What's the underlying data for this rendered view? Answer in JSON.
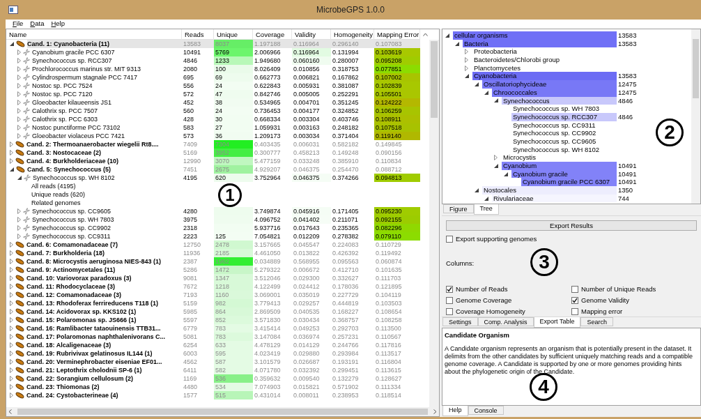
{
  "window": {
    "title": "MicrobeGPS 1.0.0"
  },
  "menu": [
    "File",
    "Data",
    "Help"
  ],
  "table": {
    "columns": [
      "Name",
      "Reads",
      "Unique",
      "Coverage",
      "Validity",
      "Homogeneity",
      "Mapping Error"
    ],
    "rows": [
      {
        "kind": "candidate",
        "name": "Cand. 1: Cyanobacteria (11)",
        "expanded": true,
        "selected": true,
        "reads": "13583",
        "unique": {
          "value": "8037",
          "color": "#66ee66"
        },
        "coverage": "1.197188",
        "validity": "0.116964",
        "homogeneity": "0.296140",
        "mapping_error": "0.107083",
        "children": [
          {
            "kind": "genome",
            "name": "Cyanobium gracile PCC 6307",
            "expanded": false,
            "selected": false,
            "reads": "10491",
            "unique": {
              "value": "5769",
              "color": "#6cf56c"
            },
            "coverage": "2.006966",
            "validity": {
              "value": "0.116964",
              "color": "#e2fbe2"
            },
            "homogeneity": "0.131994",
            "mapping_error": {
              "value": "0.103619",
              "color": "#a8c800"
            }
          },
          {
            "kind": "genome",
            "name": "Synechococcus sp. RCC307",
            "expanded": false,
            "selected": false,
            "reads": "4846",
            "unique": {
              "value": "1233",
              "color": "#b8f8b8"
            },
            "coverage": "1.949680",
            "validity": {
              "value": "0.060160",
              "color": "#f0fcf0"
            },
            "homogeneity": "0.280007",
            "mapping_error": {
              "value": "0.095208",
              "color": "#a0cc00"
            }
          },
          {
            "kind": "genome",
            "name": "Prochlorococcus marinus str. MIT 9313",
            "expanded": false,
            "selected": false,
            "reads": "2080",
            "unique": {
              "value": "100",
              "color": "#eafbea"
            },
            "coverage": "8.026409",
            "validity": "0.010856",
            "homogeneity": "0.318753",
            "mapping_error": {
              "value": "0.077851",
              "color": "#8cdc00"
            }
          },
          {
            "kind": "genome",
            "name": "Cylindrospermum stagnale PCC 7417",
            "expanded": false,
            "selected": false,
            "reads": "695",
            "unique": {
              "value": "69",
              "color": "#eefcee"
            },
            "coverage": "0.662773",
            "validity": "0.006821",
            "homogeneity": "0.167862",
            "mapping_error": {
              "value": "0.107002",
              "color": "#a8c400"
            }
          },
          {
            "kind": "genome",
            "name": "Nostoc sp. PCC 7524",
            "expanded": false,
            "selected": false,
            "reads": "556",
            "unique": {
              "value": "24",
              "color": "#f3fdf3"
            },
            "coverage": "0.622843",
            "validity": "0.005931",
            "homogeneity": "0.381087",
            "mapping_error": {
              "value": "0.102839",
              "color": "#a8c800"
            }
          },
          {
            "kind": "genome",
            "name": "Nostoc sp. PCC 7120",
            "expanded": false,
            "selected": false,
            "reads": "572",
            "unique": {
              "value": "47",
              "color": "#effcef"
            },
            "coverage": "0.842746",
            "validity": "0.005005",
            "homogeneity": "0.252291",
            "mapping_error": {
              "value": "0.105501",
              "color": "#aac600"
            }
          },
          {
            "kind": "genome",
            "name": "Gloeobacter kilaueensis JS1",
            "expanded": false,
            "selected": false,
            "reads": "452",
            "unique": {
              "value": "38",
              "color": "#f1fcf1"
            },
            "coverage": "0.534965",
            "validity": "0.004701",
            "homogeneity": "0.351245",
            "mapping_error": {
              "value": "0.124222",
              "color": "#b4b800"
            }
          },
          {
            "kind": "genome",
            "name": "Calothrix sp. PCC 7507",
            "expanded": false,
            "selected": false,
            "reads": "560",
            "unique": {
              "value": "24",
              "color": "#f3fdf3"
            },
            "coverage": "0.736453",
            "validity": "0.004177",
            "homogeneity": "0.324852",
            "mapping_error": {
              "value": "0.106259",
              "color": "#a8c400"
            }
          },
          {
            "kind": "genome",
            "name": "Calothrix sp. PCC 6303",
            "expanded": false,
            "selected": false,
            "reads": "428",
            "unique": {
              "value": "30",
              "color": "#f2fdf2"
            },
            "coverage": "0.668334",
            "validity": "0.003304",
            "homogeneity": "0.403746",
            "mapping_error": {
              "value": "0.108911",
              "color": "#acc000"
            }
          },
          {
            "kind": "genome",
            "name": "Nostoc punctiforme PCC 73102",
            "expanded": false,
            "selected": false,
            "reads": "583",
            "unique": {
              "value": "27",
              "color": "#f2fdf2"
            },
            "coverage": "1.059931",
            "validity": "0.003163",
            "homogeneity": "0.248182",
            "mapping_error": {
              "value": "0.107518",
              "color": "#a8c200"
            }
          },
          {
            "kind": "genome",
            "name": "Gloeobacter violaceus PCC 7421",
            "expanded": false,
            "selected": false,
            "reads": "573",
            "unique": {
              "value": "36",
              "color": "#f1fcf1"
            },
            "coverage": "1.209173",
            "validity": "0.003034",
            "homogeneity": "0.371404",
            "mapping_error": {
              "value": "0.119140",
              "color": "#b0b800"
            }
          }
        ]
      },
      {
        "kind": "candidate",
        "name": "Cand. 2: Thermoanaerobacter wiegelii Rt8....",
        "expanded": false,
        "selected": false,
        "reads": "7409",
        "unique": {
          "value": "7304",
          "color": "#22ee22"
        },
        "coverage": "0.403435",
        "validity": "0.006031",
        "homogeneity": "0.582182",
        "mapping_error": "0.149845"
      },
      {
        "kind": "candidate",
        "name": "Cand. 3: Nostocaceae (2)",
        "expanded": false,
        "selected": false,
        "reads": "5169",
        "unique": {
          "value": "3952",
          "color": "#44ee44"
        },
        "coverage": "0.300777",
        "validity": "0.458213",
        "homogeneity": "0.149248",
        "mapping_error": "0.090156"
      },
      {
        "kind": "candidate",
        "name": "Cand. 4: Burkholderiaceae (10)",
        "expanded": false,
        "selected": false,
        "reads": "12990",
        "unique": {
          "value": "3070",
          "color": "#c0f7c0"
        },
        "coverage": "5.477159",
        "validity": "0.033248",
        "homogeneity": "0.385910",
        "mapping_error": "0.110834"
      },
      {
        "kind": "candidate",
        "name": "Cand. 5: Synechococcus (5)",
        "expanded": true,
        "selected": false,
        "reads": "7451",
        "unique": {
          "value": "2675",
          "color": "#a0f2a0"
        },
        "coverage": "4.929207",
        "validity": "0.046375",
        "homogeneity": "0.254470",
        "mapping_error": "0.088712",
        "children": [
          {
            "kind": "genome",
            "name": "Synechococcus sp. WH 8102",
            "expanded": true,
            "selected": false,
            "reads": "4195",
            "unique": {
              "value": "620",
              "color": "#eefcee"
            },
            "coverage": "3.752964",
            "validity": {
              "value": "0.046375",
              "color": "#f5fdf5"
            },
            "homogeneity": "0.374266",
            "mapping_error": {
              "value": "0.094813",
              "color": "#a0cc00"
            },
            "children": [
              {
                "kind": "info",
                "name": "All reads (4195)",
                "selected": false
              },
              {
                "kind": "info",
                "name": "Unique reads (620)",
                "selected": false
              },
              {
                "kind": "info",
                "name": "Related genomes",
                "selected": false
              }
            ]
          },
          {
            "kind": "genome",
            "name": "Synechococcus sp. CC9605",
            "expanded": false,
            "selected": false,
            "reads": "4280",
            "unique": {
              "color": "#eefcee"
            },
            "coverage": "3.749874",
            "validity": {
              "value": "0.045916",
              "color": "#f5fdf5"
            },
            "homogeneity": "0.171405",
            "mapping_error": {
              "value": "0.095230",
              "color": "#a0cc00"
            }
          },
          {
            "kind": "genome",
            "name": "Synechococcus sp. WH 7803",
            "expanded": false,
            "selected": false,
            "reads": "3975",
            "unique": {
              "color": "#effcef"
            },
            "coverage": "4.096752",
            "validity": {
              "value": "0.041402",
              "color": "#f6fdf6"
            },
            "homogeneity": "0.211071",
            "mapping_error": {
              "value": "0.092155",
              "color": "#9ccc00"
            }
          },
          {
            "kind": "genome",
            "name": "Synechococcus sp. CC9902",
            "expanded": false,
            "selected": false,
            "reads": "2318",
            "unique": {
              "color": "#f2fdf2"
            },
            "coverage": "5.937716",
            "validity": "0.017643",
            "homogeneity": "0.235365",
            "mapping_error": {
              "value": "0.082296",
              "color": "#90d800"
            }
          },
          {
            "kind": "genome",
            "name": "Synechococcus sp. CC9311",
            "expanded": false,
            "selected": false,
            "reads": "2223",
            "unique": {
              "value": "125",
              "color": "#f3fdf3"
            },
            "coverage": "7.054821",
            "validity": "0.012209",
            "homogeneity": "0.278382",
            "mapping_error": {
              "value": "0.079110",
              "color": "#8cdc00"
            }
          }
        ]
      },
      {
        "kind": "candidate",
        "name": "Cand. 6: Comamonadaceae (7)",
        "expanded": false,
        "selected": false,
        "reads": "12750",
        "unique": {
          "value": "2478",
          "color": "#d0f8d0"
        },
        "coverage": "3.157665",
        "validity": "0.045547",
        "homogeneity": "0.224083",
        "mapping_error": "0.110729"
      },
      {
        "kind": "candidate",
        "name": "Cand. 7: Burkholderia (18)",
        "expanded": false,
        "selected": false,
        "reads": "11936",
        "unique": {
          "value": "2185",
          "color": "#d8f9d8"
        },
        "coverage": "4.461050",
        "validity": "0.013822",
        "homogeneity": "0.426392",
        "mapping_error": "0.119492"
      },
      {
        "kind": "candidate",
        "name": "Cand. 8: Microcystis aeruginosa NIES-843 (1)",
        "expanded": false,
        "selected": false,
        "reads": "2387",
        "unique": {
          "value": "1962",
          "color": "#33ee33"
        },
        "coverage": "0.034889",
        "validity": "0.568955",
        "homogeneity": "0.095563",
        "mapping_error": "0.060874"
      },
      {
        "kind": "candidate",
        "name": "Cand. 9: Actinomycetales (11)",
        "expanded": false,
        "selected": false,
        "reads": "5286",
        "unique": {
          "value": "1472",
          "color": "#c8f6c8"
        },
        "coverage": "5.279322",
        "validity": "0.006672",
        "homogeneity": "0.412710",
        "mapping_error": "0.101635"
      },
      {
        "kind": "candidate",
        "name": "Cand. 10: Variovorax paradoxus (3)",
        "expanded": false,
        "selected": false,
        "reads": "9081",
        "unique": {
          "value": "1347",
          "color": "#d8f9d8"
        },
        "coverage": "3.512046",
        "validity": "0.029300",
        "homogeneity": "0.332627",
        "mapping_error": "0.111703"
      },
      {
        "kind": "candidate",
        "name": "Cand. 11: Rhodocyclaceae (3)",
        "expanded": false,
        "selected": false,
        "reads": "7672",
        "unique": {
          "value": "1218",
          "color": "#d8f9d8"
        },
        "coverage": "4.122499",
        "validity": "0.024412",
        "homogeneity": "0.178036",
        "mapping_error": "0.121895"
      },
      {
        "kind": "candidate",
        "name": "Cand. 12: Comamonadaceae (3)",
        "expanded": false,
        "selected": false,
        "reads": "7193",
        "unique": {
          "value": "1160",
          "color": "#daf9da"
        },
        "coverage": "3.069001",
        "validity": "0.035019",
        "homogeneity": "0.227729",
        "mapping_error": "0.104119"
      },
      {
        "kind": "candidate",
        "name": "Cand. 13: Rhodoferax ferrireducens T118 (1)",
        "expanded": false,
        "selected": false,
        "reads": "5159",
        "unique": {
          "value": "982",
          "color": "#d4f9d4"
        },
        "coverage": "3.779413",
        "validity": "0.029257",
        "homogeneity": "0.444819",
        "mapping_error": "0.103503"
      },
      {
        "kind": "candidate",
        "name": "Cand. 14: Acidovorax sp. KKS102 (1)",
        "expanded": false,
        "selected": false,
        "reads": "5985",
        "unique": {
          "value": "864",
          "color": "#d8f9d8"
        },
        "coverage": "2.869509",
        "validity": "0.040535",
        "homogeneity": "0.168227",
        "mapping_error": "0.108654"
      },
      {
        "kind": "candidate",
        "name": "Cand. 15: Polaromonas sp. JS666 (1)",
        "expanded": false,
        "selected": false,
        "reads": "5597",
        "unique": {
          "value": "852",
          "color": "#dcfadc"
        },
        "coverage": "3.571830",
        "validity": "0.030434",
        "homogeneity": "0.368757",
        "mapping_error": "0.108258"
      },
      {
        "kind": "candidate",
        "name": "Cand. 16: Ramlibacter tataouinensis TTB31...",
        "expanded": false,
        "selected": false,
        "reads": "6779",
        "unique": {
          "value": "783",
          "color": "#e4fbe4"
        },
        "coverage": "3.415414",
        "validity": "0.049253",
        "homogeneity": "0.292703",
        "mapping_error": "0.113500"
      },
      {
        "kind": "candidate",
        "name": "Cand. 17: Polaromonas naphthalenivorans C...",
        "expanded": false,
        "selected": false,
        "reads": "5081",
        "unique": {
          "value": "783",
          "color": "#dcfadc"
        },
        "coverage": "3.147084",
        "validity": "0.036974",
        "homogeneity": "0.257231",
        "mapping_error": "0.110567"
      },
      {
        "kind": "candidate",
        "name": "Cand. 18: Alcaligenaceae (3)",
        "expanded": false,
        "selected": false,
        "reads": "6254",
        "unique": {
          "value": "633",
          "color": "#e4fbe4"
        },
        "coverage": "4.478129",
        "validity": "0.014129",
        "homogeneity": "0.244766",
        "mapping_error": "0.117816"
      },
      {
        "kind": "candidate",
        "name": "Cand. 19: Rubrivivax gelatinosus IL144 (1)",
        "expanded": false,
        "selected": false,
        "reads": "6003",
        "unique": {
          "value": "595",
          "color": "#e4fbe4"
        },
        "coverage": "4.023419",
        "validity": "0.029880",
        "homogeneity": "0.293984",
        "mapping_error": "0.113517"
      },
      {
        "kind": "candidate",
        "name": "Cand. 20: Verminephrobacter eiseniae EF01...",
        "expanded": false,
        "selected": false,
        "reads": "4562",
        "unique": {
          "value": "587",
          "color": "#e4fbe4"
        },
        "coverage": "3.101579",
        "validity": "0.026687",
        "homogeneity": "0.193191",
        "mapping_error": "0.116804"
      },
      {
        "kind": "candidate",
        "name": "Cand. 21: Leptothrix cholodnii SP-6 (1)",
        "expanded": false,
        "selected": false,
        "reads": "6411",
        "unique": {
          "value": "582",
          "color": "#e4fbe4"
        },
        "coverage": "4.071780",
        "validity": "0.032392",
        "homogeneity": "0.299451",
        "mapping_error": "0.113615"
      },
      {
        "kind": "candidate",
        "name": "Cand. 22: Sorangium cellulosum (2)",
        "expanded": false,
        "selected": false,
        "reads": "1169",
        "unique": {
          "value": "536",
          "color": "#88f088"
        },
        "coverage": "0.359632",
        "validity": "0.009540",
        "homogeneity": "0.132279",
        "mapping_error": "0.128627"
      },
      {
        "kind": "candidate",
        "name": "Cand. 23: Thiomonas (2)",
        "expanded": false,
        "selected": false,
        "reads": "4480",
        "unique": {
          "value": "534",
          "color": "#e4fbe4"
        },
        "coverage": "7.074903",
        "validity": "0.015821",
        "homogeneity": "0.571902",
        "mapping_error": "0.111334"
      },
      {
        "kind": "candidate",
        "name": "Cand. 24: Cystobacterineae (4)",
        "expanded": false,
        "selected": false,
        "reads": "1577",
        "unique": {
          "value": "515",
          "color": "#b8f5b8"
        },
        "coverage": "0.431014",
        "validity": "0.008011",
        "homogeneity": "0.238953",
        "mapping_error": "0.118514"
      }
    ]
  },
  "tree": {
    "items": [
      {
        "kind": "group",
        "label": "cellular organisms",
        "count": "13583",
        "color": "#7070f6",
        "expanded": true,
        "children": [
          {
            "kind": "group",
            "label": "Bacteria",
            "count": "13583",
            "color": "#7070f6",
            "expanded": true,
            "children": [
              {
                "kind": "group",
                "label": "Proteobacteria",
                "expanded": false
              },
              {
                "kind": "group",
                "label": "Bacteroidetes/Chlorobi group",
                "expanded": false
              },
              {
                "kind": "group",
                "label": "Planctomycetes",
                "expanded": false
              },
              {
                "kind": "group",
                "label": "Cyanobacteria",
                "count": "13583",
                "color": "#6c6cf4",
                "expanded": true,
                "children": [
                  {
                    "kind": "group",
                    "label": "Oscillatoriophycideae",
                    "count": "12475",
                    "color": "#7878f6",
                    "expanded": true,
                    "children": [
                      {
                        "kind": "group",
                        "label": "Chroococcales",
                        "count": "12475",
                        "color": "#7878f6",
                        "expanded": true,
                        "children": [
                          {
                            "kind": "group",
                            "label": "Synechococcus",
                            "count": "4846",
                            "color": "#c8c8fb",
                            "expanded": true,
                            "children": [
                              {
                                "kind": "leaf",
                                "label": "Synechococcus sp. WH 7803"
                              },
                              {
                                "kind": "leaf",
                                "label": "Synechococcus sp. RCC307",
                                "count": "4846",
                                "color": "#c8c8fb"
                              },
                              {
                                "kind": "leaf",
                                "label": "Synechococcus sp. CC9311"
                              },
                              {
                                "kind": "leaf",
                                "label": "Synechococcus sp. CC9902"
                              },
                              {
                                "kind": "leaf",
                                "label": "Synechococcus sp. CC9605"
                              },
                              {
                                "kind": "leaf",
                                "label": "Synechococcus sp. WH 8102"
                              }
                            ]
                          },
                          {
                            "kind": "group",
                            "label": "Microcystis",
                            "expanded": false
                          },
                          {
                            "kind": "group",
                            "label": "Cyanobium",
                            "count": "10491",
                            "color": "#8282f8",
                            "expanded": true,
                            "children": [
                              {
                                "kind": "group",
                                "label": "Cyanobium gracile",
                                "count": "10491",
                                "color": "#8282f8",
                                "expanded": true,
                                "children": [
                                  {
                                    "kind": "leaf",
                                    "label": "Cyanobium gracile PCC 6307",
                                    "count": "10491",
                                    "color": "#8282f8"
                                  }
                                ]
                              }
                            ]
                          }
                        ]
                      }
                    ]
                  },
                  {
                    "kind": "group",
                    "label": "Nostocales",
                    "count": "1350",
                    "color": "#ededfd",
                    "expanded": true,
                    "children": [
                      {
                        "kind": "group",
                        "label": "Rivulariaceae",
                        "count": "744",
                        "color": "#f5f5fe",
                        "expanded": true
                      }
                    ]
                  }
                ]
              }
            ]
          }
        ]
      }
    ]
  },
  "view_tabs": [
    {
      "label": "Figure",
      "selected": false
    },
    {
      "label": "Tree",
      "selected": true
    }
  ],
  "export": {
    "button": "Export Results",
    "supporting": {
      "label": "Export supporting genomes",
      "checked": false
    },
    "columns_label": "Columns:",
    "columns": [
      {
        "label": "Number of Reads",
        "checked": true
      },
      {
        "label": "Number of Unique Reads",
        "checked": false
      },
      {
        "label": "Genome Coverage",
        "checked": false
      },
      {
        "label": "Genome Validity",
        "checked": true
      },
      {
        "label": "Coverage Homogeneity",
        "checked": false
      },
      {
        "label": "Mapping error",
        "checked": false
      }
    ]
  },
  "tool_tabs": [
    {
      "label": "Settings",
      "selected": false
    },
    {
      "label": "Comp. Analysis",
      "selected": false
    },
    {
      "label": "Export Table",
      "selected": true
    },
    {
      "label": "Search",
      "selected": false
    }
  ],
  "help": {
    "title": "Candidate Organism",
    "text": "A Candidate organism represents an organism that is potentially present in the dataset. It delimits from the other candidates by sufficient uniquely matching reads and a compatible genome coverage. A Candidate is supported by one or more genomes providing hints about the phylogenetic origin of the Candidate."
  },
  "bottom_tabs": [
    {
      "label": "Help",
      "selected": true
    },
    {
      "label": "Console",
      "selected": false
    }
  ],
  "callouts": [
    {
      "kind": "table",
      "label": "1"
    },
    {
      "kind": "tree",
      "label": "2"
    },
    {
      "kind": "export",
      "label": "3"
    },
    {
      "kind": "help",
      "label": "4"
    }
  ]
}
